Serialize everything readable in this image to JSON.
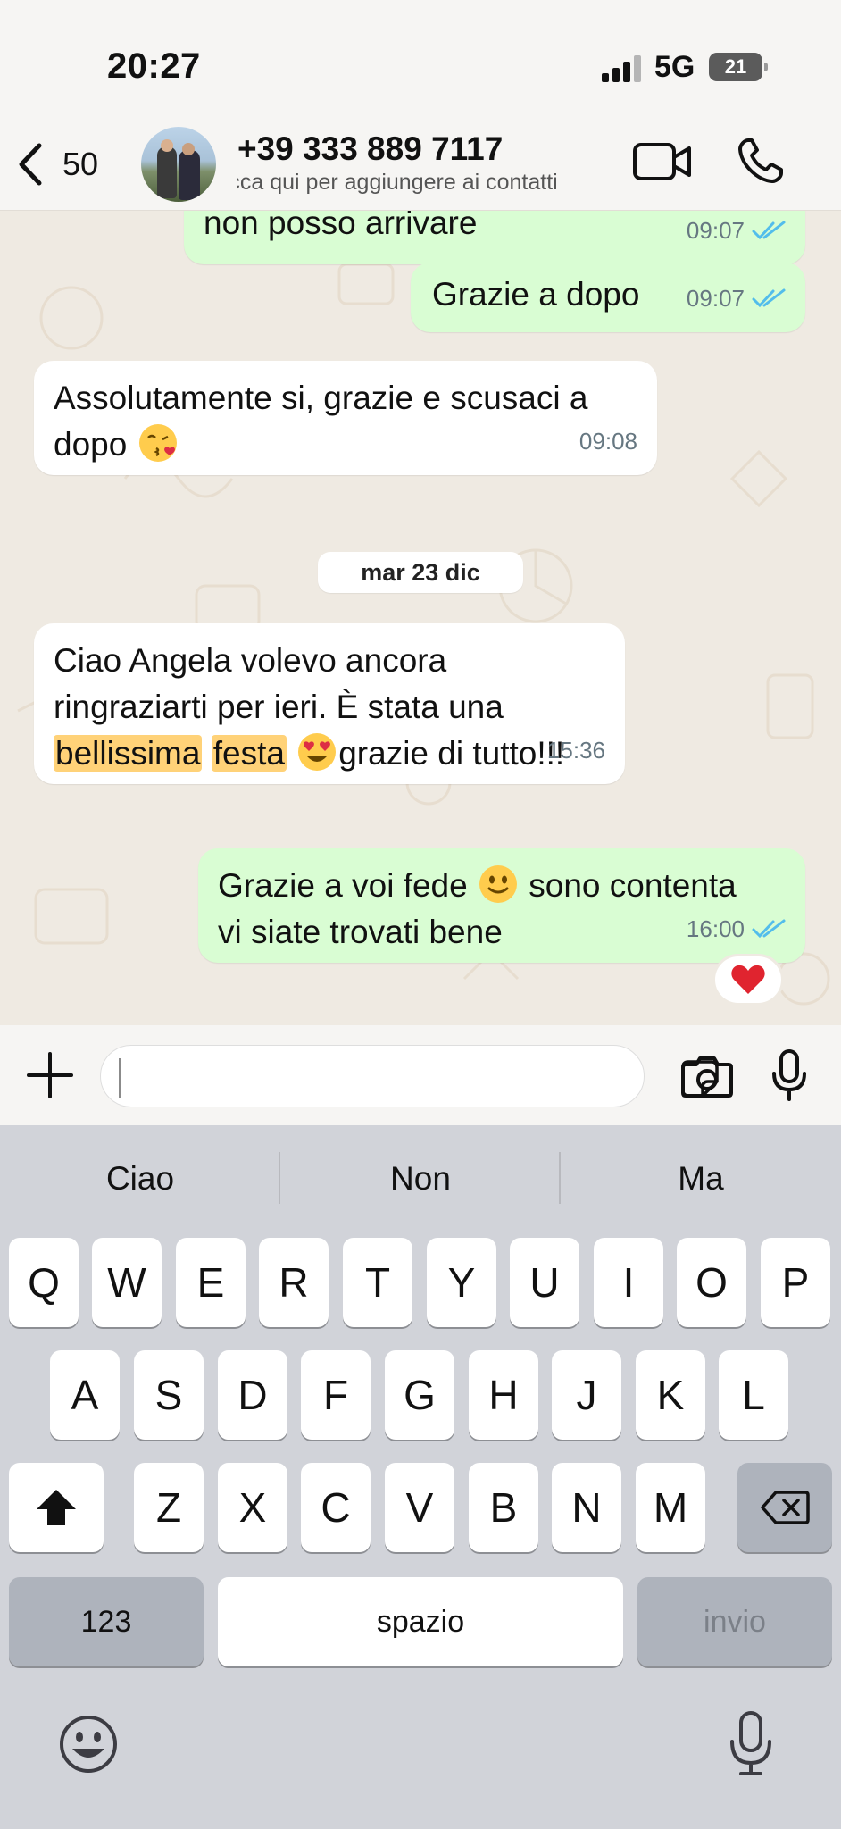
{
  "status_bar": {
    "time": "20:27",
    "network": "5G",
    "battery": "21"
  },
  "header": {
    "back_count": "50",
    "contact_name": "+39 333 889 7117",
    "contact_subtitle": "Tocca qui per aggiungere ai contatti"
  },
  "messages": [
    {
      "direction": "outgoing",
      "text": "non posso arrivare",
      "time": "09:07",
      "status": "read"
    },
    {
      "direction": "outgoing",
      "text": "Grazie a dopo",
      "time": "09:07",
      "status": "read"
    },
    {
      "direction": "incoming",
      "line1": "Assolutamente si, grazie e scusaci a",
      "line2": "dopo",
      "emoji": "kissing-face-with-heart",
      "time": "09:08"
    },
    {
      "direction": "incoming",
      "line1": "Ciao Angela volevo ancora",
      "line2": "ringraziarti per ieri. È stata una",
      "hl1": "bellissima",
      "hl2": "festa",
      "emoji": "heart-eyes-face",
      "tail": "grazie di tutto!!!",
      "time": "15:36"
    },
    {
      "direction": "outgoing",
      "part1": "Grazie a voi fede",
      "emoji": "slightly-smiling-face",
      "part2": "sono contenta",
      "line2": "vi siate trovati bene",
      "time": "16:00",
      "status": "read",
      "reaction": "red-heart"
    }
  ],
  "date_separator": "mar 23 dic",
  "composer": {
    "input_value": ""
  },
  "keyboard": {
    "suggestions": [
      "Ciao",
      "Non",
      "Ma"
    ],
    "row1": [
      "Q",
      "W",
      "E",
      "R",
      "T",
      "Y",
      "U",
      "I",
      "O",
      "P"
    ],
    "row2": [
      "A",
      "S",
      "D",
      "F",
      "G",
      "H",
      "J",
      "K",
      "L"
    ],
    "row3": [
      "Z",
      "X",
      "C",
      "V",
      "B",
      "N",
      "M"
    ],
    "numbers_key": "123",
    "space_key": "spazio",
    "return_key": "invio"
  },
  "colors": {
    "outgoing_bubble": "#d9fdd3",
    "incoming_bubble": "#ffffff",
    "chat_background": "#efeae2",
    "read_ticks": "#53bdeb",
    "highlight": "#ffd278",
    "keyboard_background": "#d1d3d9"
  }
}
